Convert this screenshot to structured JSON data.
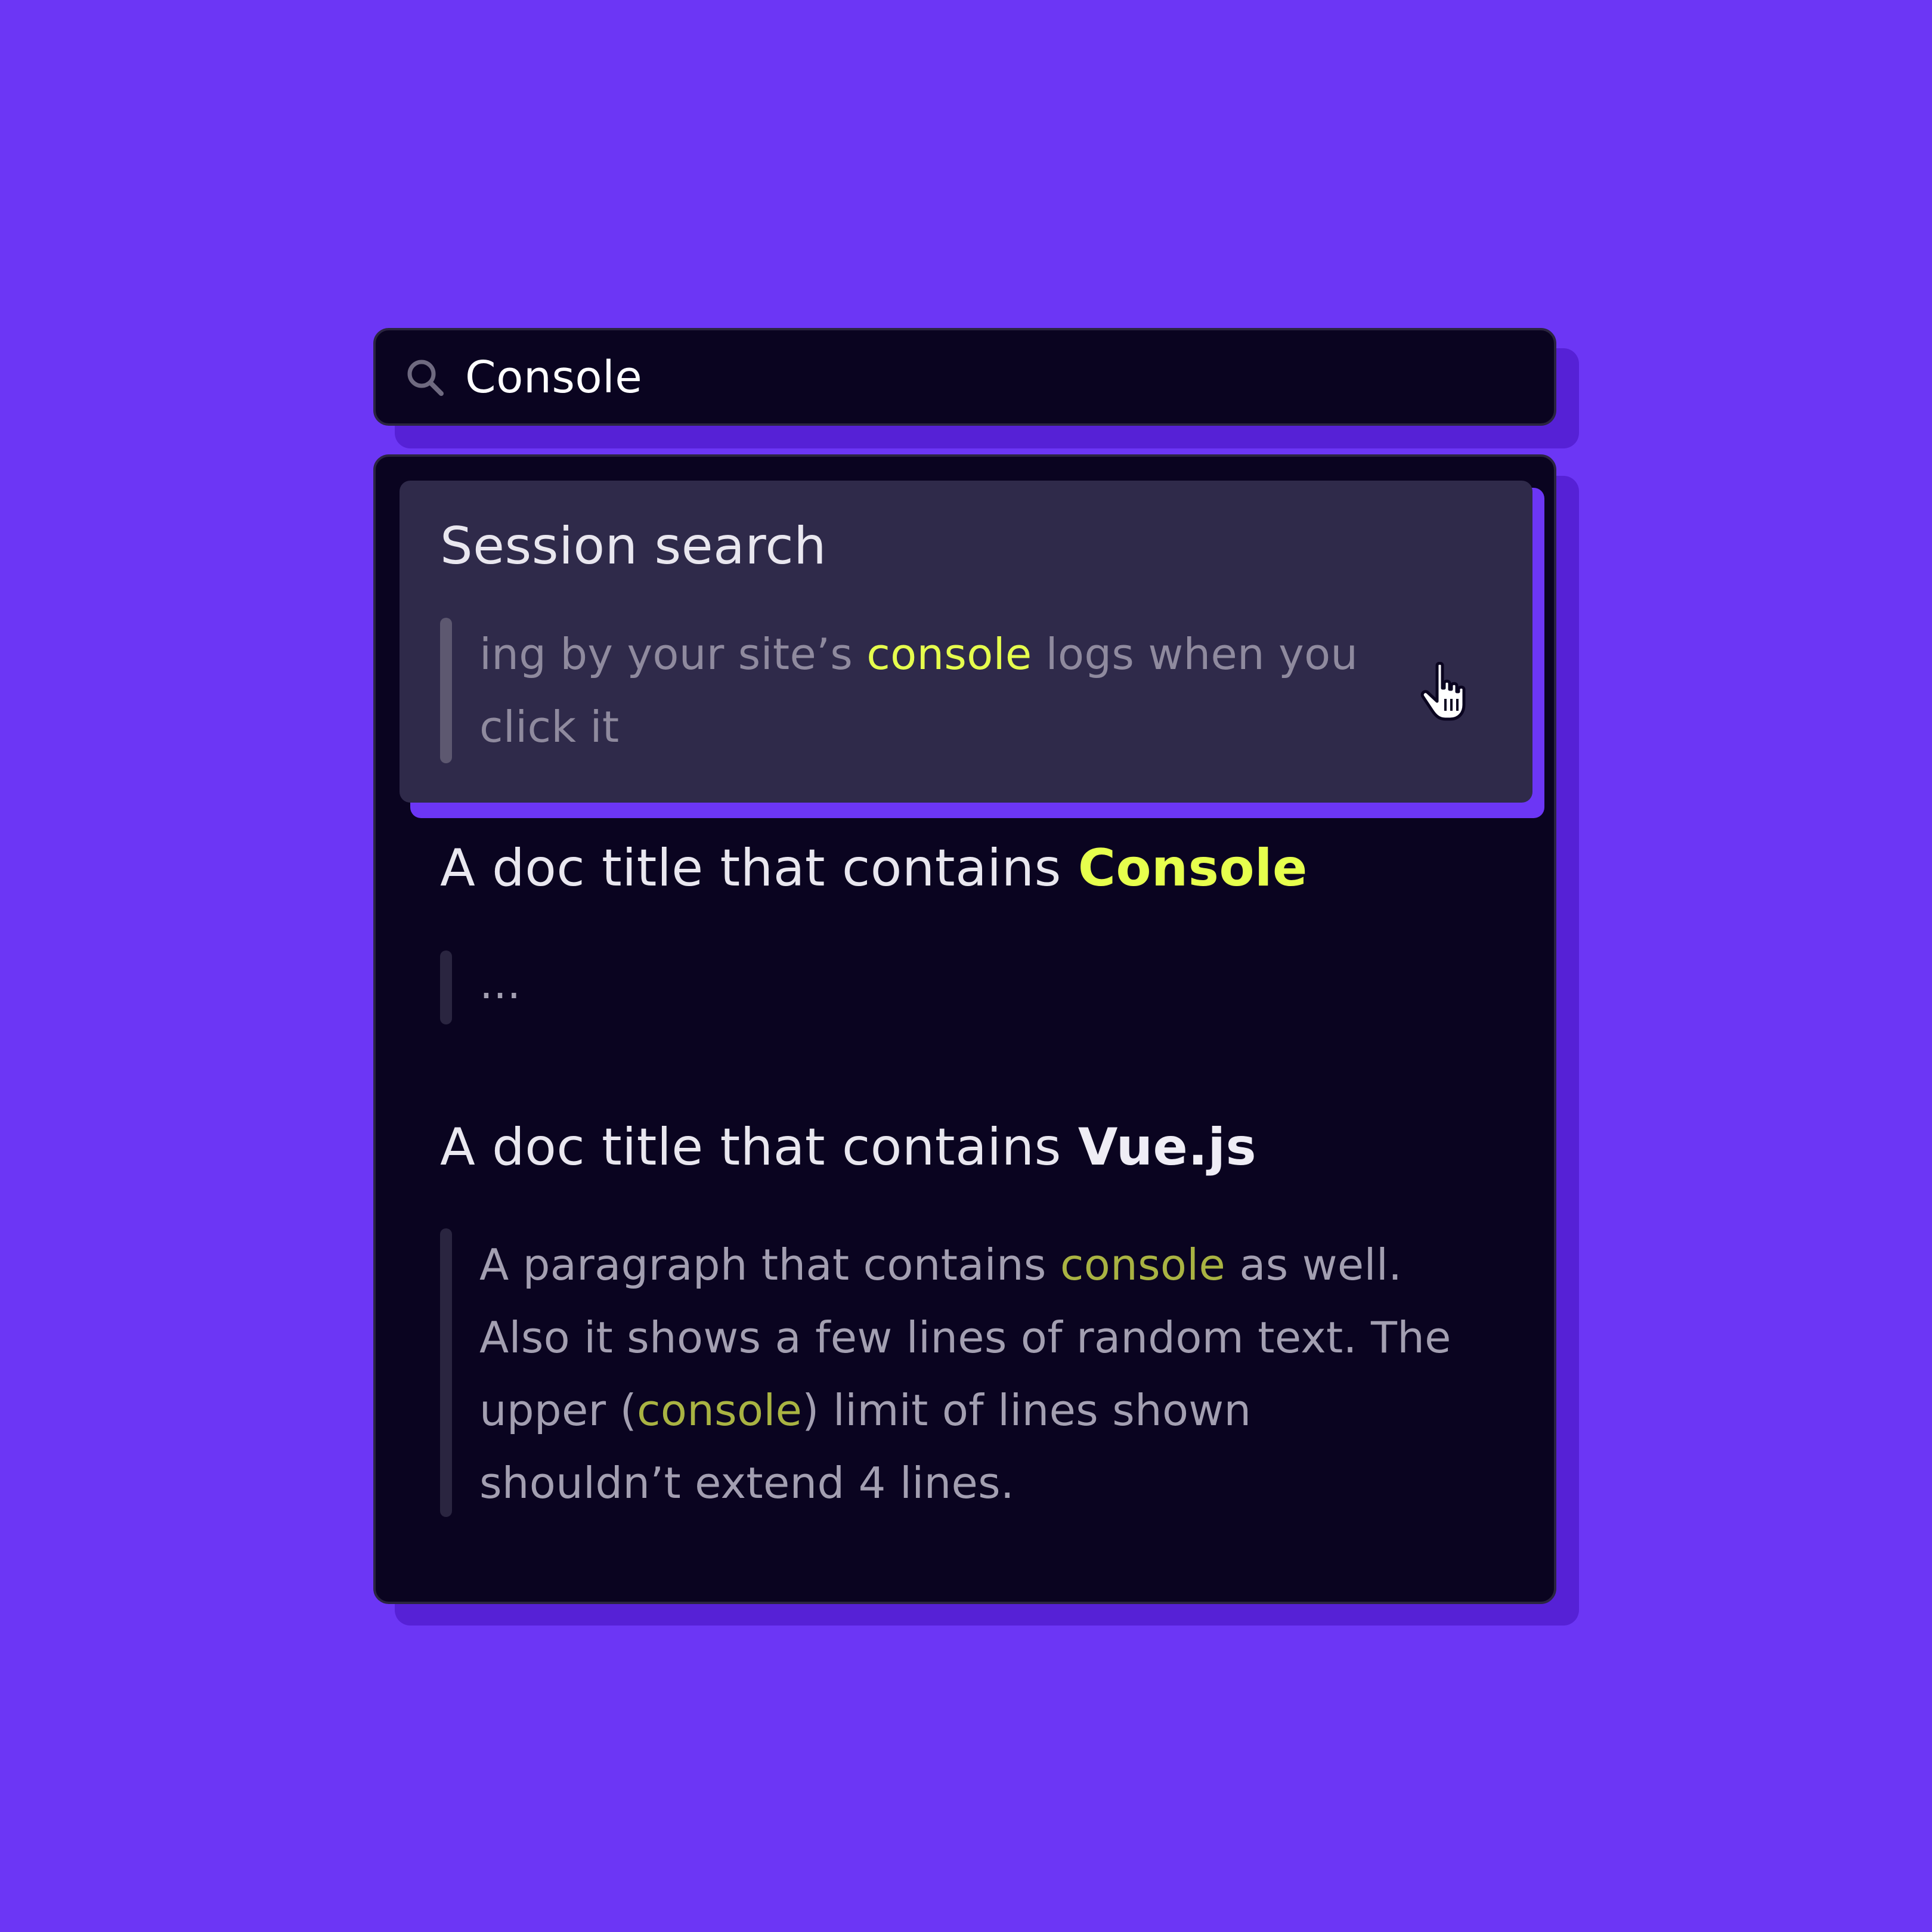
{
  "search": {
    "value": "Console",
    "icon": "search-icon"
  },
  "results": [
    {
      "title": "Session search",
      "excerpt_before": "ing by your site’s ",
      "excerpt_match": "console",
      "excerpt_after_line1": " logs when you",
      "excerpt_line2": "click it",
      "active": true
    },
    {
      "title_prefix": "A doc title that contains ",
      "title_match": "Console",
      "excerpt": "..."
    },
    {
      "title_prefix": "A doc title that contains ",
      "title_strong": "Vue.js",
      "excerpt_l1_before": "A paragraph that contains ",
      "excerpt_l1_match": "console",
      "excerpt_l1_after": " as well.",
      "excerpt_l2": "Also it shows a few lines of random text. The",
      "excerpt_l3_before": "upper (",
      "excerpt_l3_match": "console",
      "excerpt_l3_after": ") limit of lines shown",
      "excerpt_l4": "shouldn’t extend 4 lines."
    }
  ],
  "colors": {
    "background": "#6c36f5",
    "panel": "#0a0420",
    "active_row": "#2f2a4a",
    "highlight": "#e6ff4d"
  }
}
